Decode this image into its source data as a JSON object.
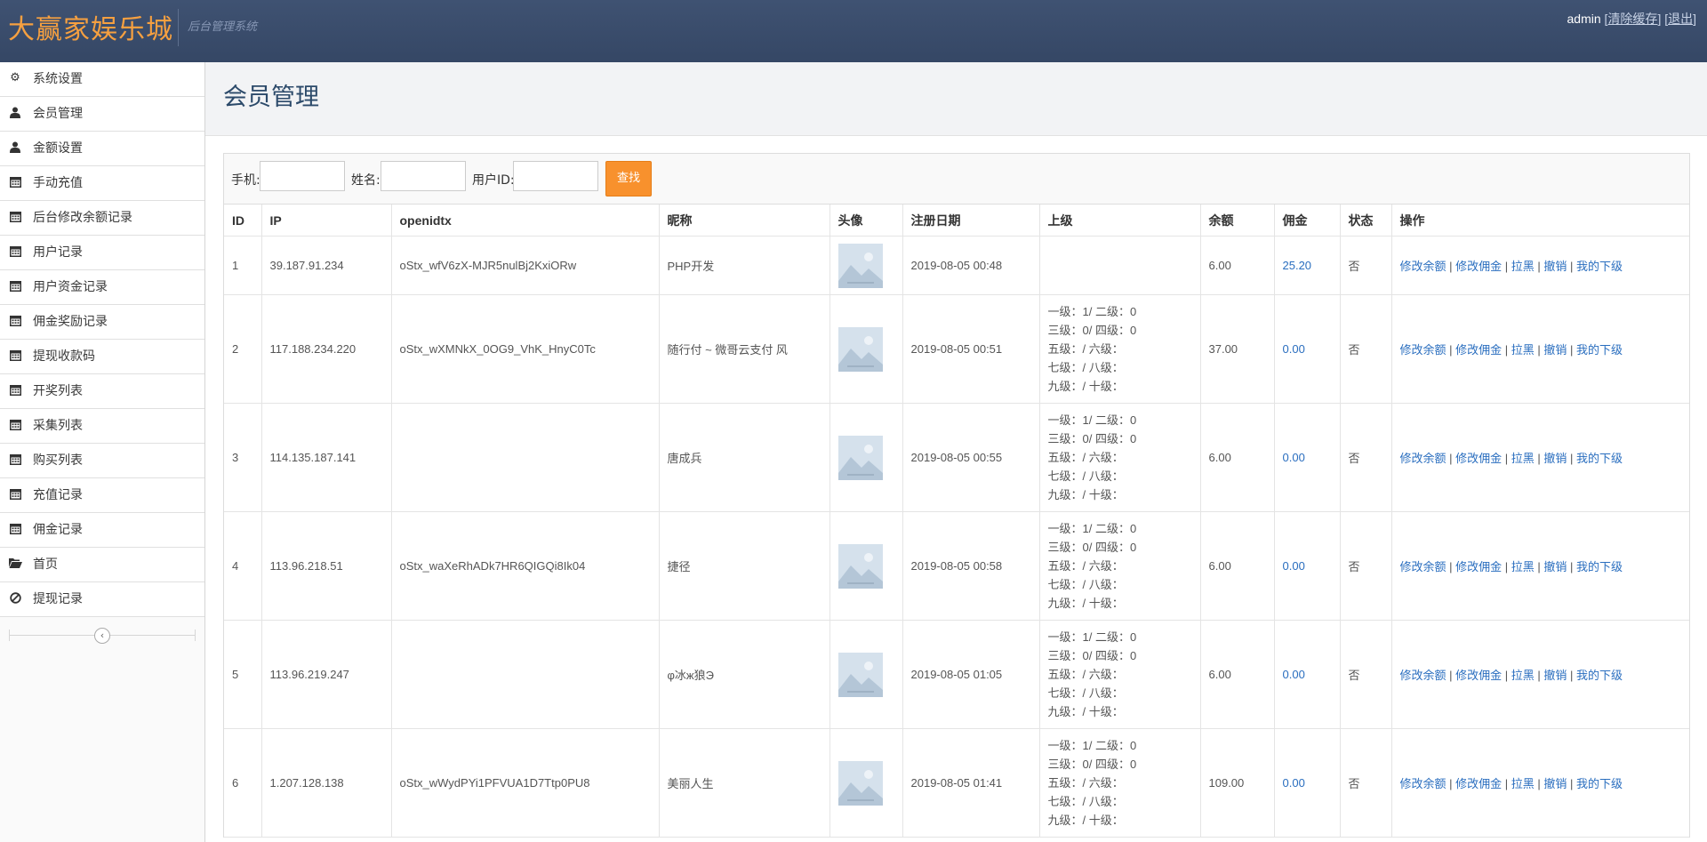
{
  "header": {
    "brand": "大赢家娱乐城",
    "subtitle": "后台管理系统",
    "user": "admin",
    "clear_cache": "清除缓存",
    "logout": "退出"
  },
  "sidebar": {
    "items": [
      {
        "label": "系统设置",
        "icon": "gear-icon"
      },
      {
        "label": "会员管理",
        "icon": "user-icon"
      },
      {
        "label": "金额设置",
        "icon": "user-icon"
      },
      {
        "label": "手动充值",
        "icon": "calendar-icon"
      },
      {
        "label": "后台修改余额记录",
        "icon": "calendar-icon"
      },
      {
        "label": "用户记录",
        "icon": "calendar-icon"
      },
      {
        "label": "用户资金记录",
        "icon": "calendar-icon"
      },
      {
        "label": "佣金奖励记录",
        "icon": "calendar-icon"
      },
      {
        "label": "提现收款码",
        "icon": "calendar-icon"
      },
      {
        "label": "开奖列表",
        "icon": "calendar-icon"
      },
      {
        "label": "采集列表",
        "icon": "calendar-icon"
      },
      {
        "label": "购买列表",
        "icon": "calendar-icon"
      },
      {
        "label": "充值记录",
        "icon": "calendar-icon"
      },
      {
        "label": "佣金记录",
        "icon": "calendar-icon"
      },
      {
        "label": "首页",
        "icon": "folder-open-icon"
      },
      {
        "label": "提现记录",
        "icon": "ban-icon"
      }
    ]
  },
  "page": {
    "title": "会员管理"
  },
  "search": {
    "phone_label": "手机:",
    "name_label": "姓名:",
    "uid_label": "用户ID:",
    "submit": "查找"
  },
  "table": {
    "headers": [
      "ID",
      "IP",
      "openidtx",
      "昵称",
      "头像",
      "注册日期",
      "上级",
      "余额",
      "佣金",
      "状态",
      "操作"
    ],
    "ops": [
      "修改余额",
      "修改佣金",
      "拉黑",
      "撤销",
      "我的下级"
    ],
    "rows": [
      {
        "id": "1",
        "ip": "39.187.91.234",
        "openid": "oStx_wfV6zX-MJR5nulBj2KxiORw",
        "nick": "PHP开发",
        "date": "2019-08-05 00:48",
        "sup": [],
        "balance": "6.00",
        "commission": "25.20",
        "status": "否"
      },
      {
        "id": "2",
        "ip": "117.188.234.220",
        "openid": "oStx_wXMNkX_0OG9_VhK_HnyC0Tc",
        "nick": "随行付 ~ 微哥云支付 风",
        "date": "2019-08-05 00:51",
        "sup": [
          "一级：1/ 二级：0",
          "三级：0/ 四级：0",
          "五级：/ 六级：",
          "七级：/ 八级：",
          "九级：/ 十级："
        ],
        "balance": "37.00",
        "commission": "0.00",
        "status": "否"
      },
      {
        "id": "3",
        "ip": "114.135.187.141",
        "openid": "",
        "nick": "唐成兵",
        "date": "2019-08-05 00:55",
        "sup": [
          "一级：1/ 二级：0",
          "三级：0/ 四级：0",
          "五级：/ 六级：",
          "七级：/ 八级：",
          "九级：/ 十级："
        ],
        "balance": "6.00",
        "commission": "0.00",
        "status": "否"
      },
      {
        "id": "4",
        "ip": "113.96.218.51",
        "openid": "oStx_waXeRhADk7HR6QIGQi8Ik04",
        "nick": "捷径",
        "date": "2019-08-05 00:58",
        "sup": [
          "一级：1/ 二级：0",
          "三级：0/ 四级：0",
          "五级：/ 六级：",
          "七级：/ 八级：",
          "九级：/ 十级："
        ],
        "balance": "6.00",
        "commission": "0.00",
        "status": "否"
      },
      {
        "id": "5",
        "ip": "113.96.219.247",
        "openid": "",
        "nick": "φ冰ж狼Э",
        "date": "2019-08-05 01:05",
        "sup": [
          "一级：1/ 二级：0",
          "三级：0/ 四级：0",
          "五级：/ 六级：",
          "七级：/ 八级：",
          "九级：/ 十级："
        ],
        "balance": "6.00",
        "commission": "0.00",
        "status": "否"
      },
      {
        "id": "6",
        "ip": "1.207.128.138",
        "openid": "oStx_wWydPYi1PFVUA1D7Ttp0PU8",
        "nick": "美丽人生",
        "date": "2019-08-05 01:41",
        "sup": [
          "一级：1/ 二级：0",
          "三级：0/ 四级：0",
          "五级：/ 六级：",
          "七级：/ 八级：",
          "九级：/ 十级："
        ],
        "balance": "109.00",
        "commission": "0.00",
        "status": "否"
      }
    ]
  }
}
